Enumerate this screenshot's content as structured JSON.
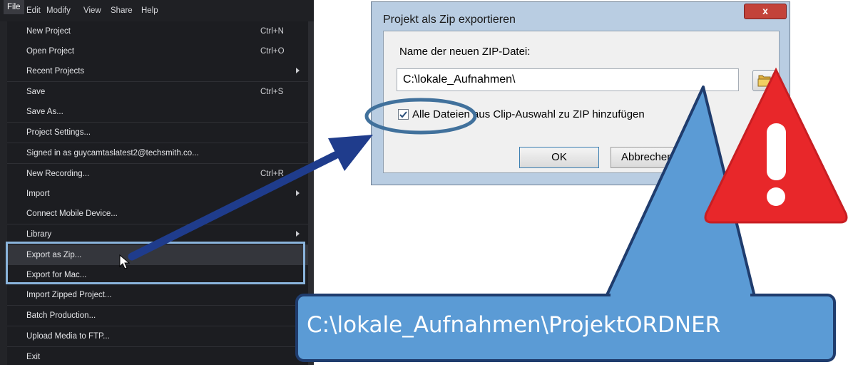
{
  "menubar": {
    "items": [
      "File",
      "Edit",
      "Modify",
      "View",
      "Share",
      "Help"
    ]
  },
  "file_menu": {
    "items": [
      {
        "label": "New Project",
        "shortcut": "Ctrl+N"
      },
      {
        "label": "Open Project",
        "shortcut": "Ctrl+O"
      },
      {
        "label": "Recent Projects",
        "shortcut": ""
      },
      {
        "label": "Save",
        "shortcut": "Ctrl+S"
      },
      {
        "label": "Save As...",
        "shortcut": ""
      },
      {
        "label": "Project Settings...",
        "shortcut": ""
      },
      {
        "label": "Signed in as guycamtaslatest2@techsmith.co...",
        "shortcut": ""
      },
      {
        "label": "New Recording...",
        "shortcut": "Ctrl+R"
      },
      {
        "label": "Import",
        "shortcut": ""
      },
      {
        "label": "Connect Mobile Device...",
        "shortcut": ""
      },
      {
        "label": "Library",
        "shortcut": ""
      },
      {
        "label": "Export as Zip...",
        "shortcut": ""
      },
      {
        "label": "Export for Mac...",
        "shortcut": ""
      },
      {
        "label": "Import Zipped Project...",
        "shortcut": ""
      },
      {
        "label": "Batch Production...",
        "shortcut": ""
      },
      {
        "label": "Upload Media to FTP...",
        "shortcut": ""
      },
      {
        "label": "Exit",
        "shortcut": ""
      }
    ]
  },
  "dialog": {
    "title": "Projekt als Zip exportieren",
    "close_label": "x",
    "zip_label": "Name der neuen ZIP-Datei:",
    "zip_value": "C:\\lokale_Aufnahmen\\",
    "checkbox_label": "Alle Dateien aus Clip-Auswahl zu ZIP hinzufügen",
    "checkbox_checked": true,
    "ok_label": "OK",
    "cancel_label": "Abbrechen"
  },
  "callout": {
    "text": "C:\\lokale_Aufnahmen\\ProjektORDNER"
  },
  "colors": {
    "menu_bg": "#1c1d21",
    "highlight_box": "#8ab4dc",
    "arrow": "#1f3c8c",
    "callout_fill": "#5b9bd5",
    "warning_red": "#e8272a"
  },
  "icons": [
    "submenu-arrow-icon",
    "mouse-cursor-icon",
    "folder-open-icon",
    "checkmark-icon",
    "warning-icon"
  ]
}
